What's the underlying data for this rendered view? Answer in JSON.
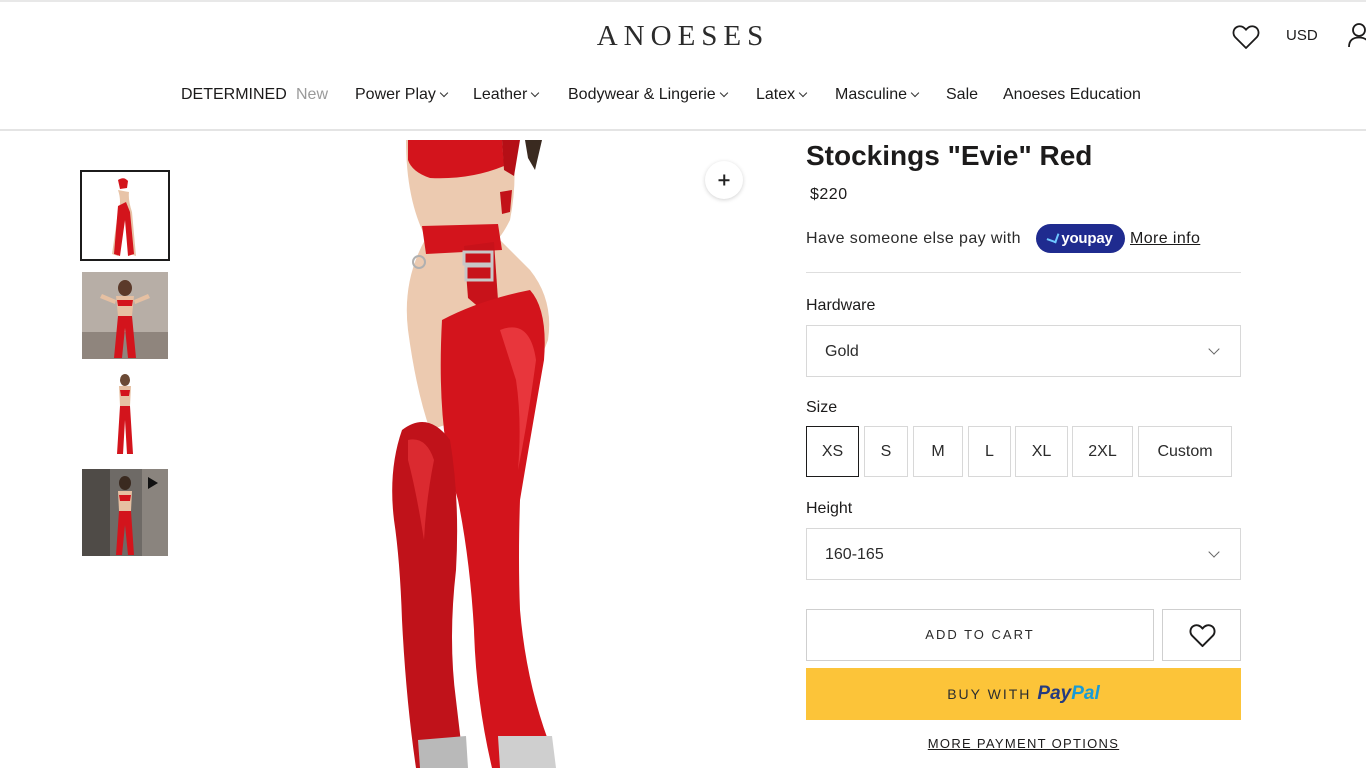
{
  "header": {
    "logo": "ANOESES",
    "currency": "USD",
    "nav": [
      {
        "label": "DETERMINED",
        "dropdown": false
      },
      {
        "label": "New",
        "dropdown": false
      },
      {
        "label": "Power Play",
        "dropdown": true
      },
      {
        "label": "Leather",
        "dropdown": true
      },
      {
        "label": "Bodywear & Lingerie",
        "dropdown": true
      },
      {
        "label": "Latex",
        "dropdown": true
      },
      {
        "label": "Masculine",
        "dropdown": true
      },
      {
        "label": "Sale",
        "dropdown": false
      },
      {
        "label": "Anoeses Education",
        "dropdown": false
      }
    ]
  },
  "gallery": {
    "thumbnails": [
      {
        "icon": "product-photo",
        "active": true
      },
      {
        "icon": "product-photo",
        "active": false
      },
      {
        "icon": "product-photo",
        "active": false
      },
      {
        "icon": "video-thumbnail",
        "active": false
      }
    ],
    "zoom_icon": "plus-icon"
  },
  "product": {
    "title": "Stockings \"Evie\" Red",
    "price": "$220",
    "youpay": {
      "text": "Have someone else pay with",
      "badge": "youpay",
      "link": "More info"
    },
    "hardware": {
      "label": "Hardware",
      "value": "Gold"
    },
    "size": {
      "label": "Size",
      "options": [
        "XS",
        "S",
        "M",
        "L",
        "XL",
        "2XL",
        "Custom"
      ],
      "selected": "XS"
    },
    "height": {
      "label": "Height",
      "value": "160-165"
    },
    "add_to_cart": "ADD TO CART",
    "paypal": {
      "prefix": "BUY WITH",
      "pay": "Pay",
      "pal": "Pal"
    },
    "more_payment": "MORE PAYMENT OPTIONS"
  },
  "colors": {
    "accent": "#fcc439",
    "youpay": "#1f2b8f",
    "latex_red": "#d3141c",
    "text": "#1c1b1b"
  }
}
